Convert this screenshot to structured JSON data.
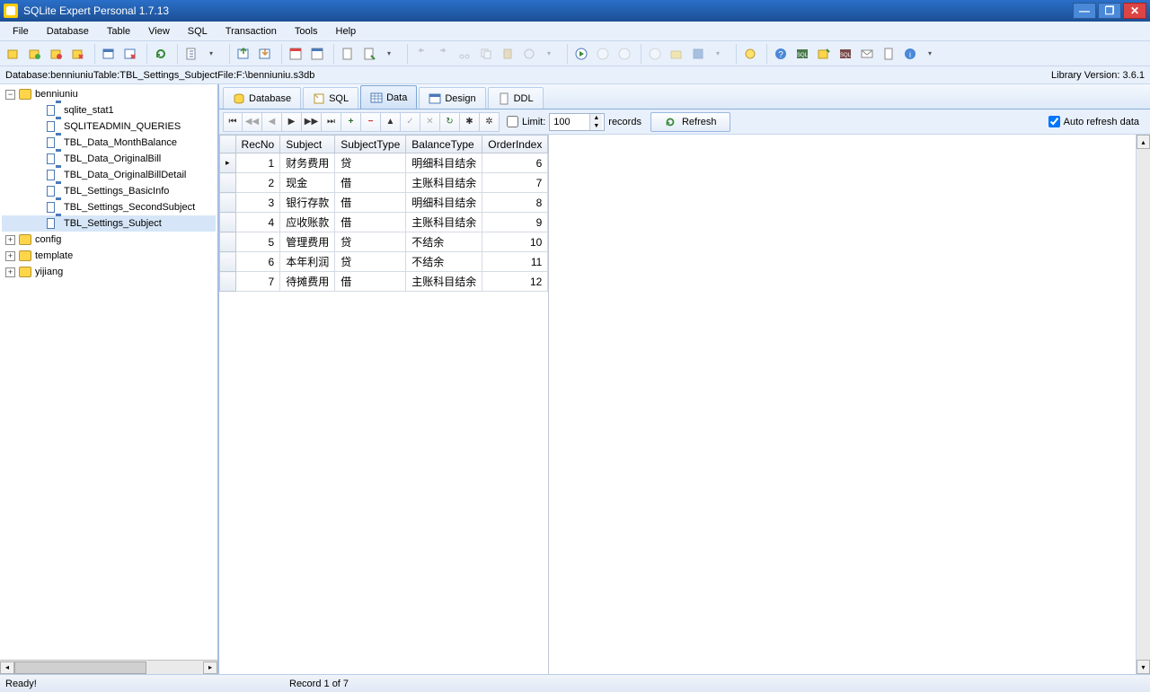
{
  "titlebar": {
    "title": "SQLite Expert Personal 1.7.13"
  },
  "menu": {
    "file": "File",
    "database": "Database",
    "table": "Table",
    "view": "View",
    "sql": "SQL",
    "transaction": "Transaction",
    "tools": "Tools",
    "help": "Help"
  },
  "infobar": {
    "db_label": "Database: ",
    "db": "benniuniu",
    "tbl_label": "   Table: ",
    "tbl": "TBL_Settings_Subject",
    "file_label": "   File: ",
    "file": "F:\\benniuniu.s3db",
    "lib": "Library Version: 3.6.1"
  },
  "tree": {
    "root": "benniuniu",
    "tables": [
      "sqlite_stat1",
      "SQLITEADMIN_QUERIES",
      "TBL_Data_MonthBalance",
      "TBL_Data_OriginalBill",
      "TBL_Data_OriginalBillDetail",
      "TBL_Settings_BasicInfo",
      "TBL_Settings_SecondSubject",
      "TBL_Settings_Subject"
    ],
    "other": [
      "config",
      "template",
      "yijiang"
    ]
  },
  "tabs": {
    "database": "Database",
    "sql": "SQL",
    "data": "Data",
    "design": "Design",
    "ddl": "DDL"
  },
  "nav": {
    "limit_label": "Limit:",
    "limit_value": "100",
    "records": "records",
    "refresh": "Refresh",
    "auto": "Auto refresh data"
  },
  "grid": {
    "headers": [
      "RecNo",
      "Subject",
      "SubjectType",
      "BalanceType",
      "OrderIndex"
    ],
    "rows": [
      {
        "RecNo": "1",
        "Subject": "财务费用",
        "SubjectType": "贷",
        "BalanceType": "明细科目结余",
        "OrderIndex": "6"
      },
      {
        "RecNo": "2",
        "Subject": "现金",
        "SubjectType": "借",
        "BalanceType": "主账科目结余",
        "OrderIndex": "7"
      },
      {
        "RecNo": "3",
        "Subject": "银行存款",
        "SubjectType": "借",
        "BalanceType": "明细科目结余",
        "OrderIndex": "8"
      },
      {
        "RecNo": "4",
        "Subject": "应收账款",
        "SubjectType": "借",
        "BalanceType": "主账科目结余",
        "OrderIndex": "9"
      },
      {
        "RecNo": "5",
        "Subject": "管理费用",
        "SubjectType": "贷",
        "BalanceType": "不结余",
        "OrderIndex": "10"
      },
      {
        "RecNo": "6",
        "Subject": "本年利润",
        "SubjectType": "贷",
        "BalanceType": "不结余",
        "OrderIndex": "11"
      },
      {
        "RecNo": "7",
        "Subject": "待摊费用",
        "SubjectType": "借",
        "BalanceType": "主账科目结余",
        "OrderIndex": "12"
      }
    ]
  },
  "status": {
    "ready": "Ready!",
    "record": "Record 1 of 7"
  }
}
